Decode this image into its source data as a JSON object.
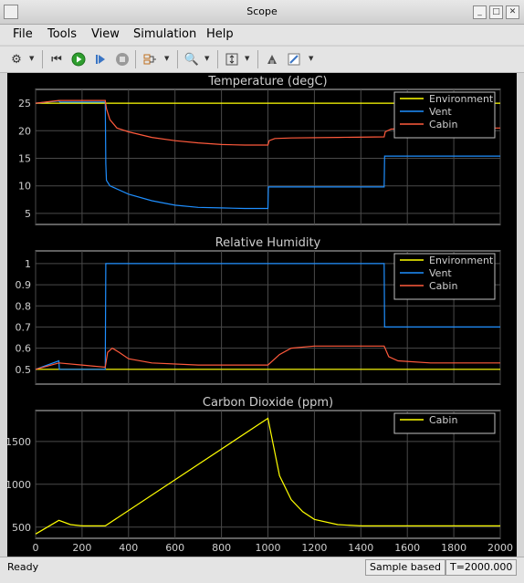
{
  "window": {
    "title": "Scope"
  },
  "menu": {
    "file": "File",
    "tools": "Tools",
    "view": "View",
    "simulation": "Simulation",
    "help": "Help"
  },
  "status": {
    "ready": "Ready",
    "mode": "Sample based",
    "time": "T=2000.000"
  },
  "colors": {
    "environment": "#ffff00",
    "vent": "#1f8fff",
    "cabin": "#ff5a3c",
    "co2": "#ffff00"
  },
  "chart_data": [
    {
      "type": "line",
      "title": "Temperature (degC)",
      "xlim": [
        0,
        2000
      ],
      "ylim": [
        3,
        27.5
      ],
      "yticks": [
        5,
        10,
        15,
        20,
        25
      ],
      "legend": "top-right",
      "series": [
        {
          "name": "Environment",
          "color": "#ffff00",
          "points": [
            [
              0,
              25
            ],
            [
              2000,
              25
            ]
          ]
        },
        {
          "name": "Vent",
          "color": "#1f8fff",
          "points": [
            [
              0,
              25
            ],
            [
              100,
              25.4
            ],
            [
              105,
              25.2
            ],
            [
              300,
              25.2
            ],
            [
              302,
              14
            ],
            [
              305,
              11
            ],
            [
              320,
              10
            ],
            [
              400,
              8.5
            ],
            [
              500,
              7.3
            ],
            [
              600,
              6.5
            ],
            [
              700,
              6.1
            ],
            [
              800,
              6
            ],
            [
              900,
              5.9
            ],
            [
              1000,
              5.9
            ],
            [
              1002,
              9.8
            ],
            [
              1100,
              9.8
            ],
            [
              1200,
              9.8
            ],
            [
              1500,
              9.8
            ],
            [
              1502,
              15.4
            ],
            [
              1600,
              15.4
            ],
            [
              2000,
              15.4
            ]
          ]
        },
        {
          "name": "Cabin",
          "color": "#ff5a3c",
          "points": [
            [
              0,
              25
            ],
            [
              100,
              25.5
            ],
            [
              300,
              25.5
            ],
            [
              305,
              24
            ],
            [
              320,
              22
            ],
            [
              350,
              20.5
            ],
            [
              400,
              19.8
            ],
            [
              500,
              18.8
            ],
            [
              600,
              18.2
            ],
            [
              700,
              17.8
            ],
            [
              800,
              17.5
            ],
            [
              900,
              17.4
            ],
            [
              1000,
              17.4
            ],
            [
              1005,
              18.2
            ],
            [
              1030,
              18.6
            ],
            [
              1100,
              18.7
            ],
            [
              1300,
              18.8
            ],
            [
              1500,
              18.9
            ],
            [
              1505,
              19.8
            ],
            [
              1530,
              20.3
            ],
            [
              1600,
              20.4
            ],
            [
              2000,
              20.5
            ]
          ]
        }
      ]
    },
    {
      "type": "line",
      "title": "Relative Humidity",
      "xlim": [
        0,
        2000
      ],
      "ylim": [
        0.43,
        1.06
      ],
      "yticks": [
        0.5,
        0.6,
        0.7,
        0.8,
        0.9,
        1
      ],
      "legend": "top-right",
      "series": [
        {
          "name": "Environment",
          "color": "#ffff00",
          "points": [
            [
              0,
              0.5
            ],
            [
              2000,
              0.5
            ]
          ]
        },
        {
          "name": "Vent",
          "color": "#1f8fff",
          "points": [
            [
              0,
              0.5
            ],
            [
              100,
              0.54
            ],
            [
              102,
              0.5
            ],
            [
              300,
              0.5
            ],
            [
              302,
              1
            ],
            [
              1500,
              1
            ],
            [
              1502,
              0.7
            ],
            [
              2000,
              0.7
            ]
          ]
        },
        {
          "name": "Cabin",
          "color": "#ff5a3c",
          "points": [
            [
              0,
              0.5
            ],
            [
              100,
              0.53
            ],
            [
              200,
              0.52
            ],
            [
              300,
              0.51
            ],
            [
              310,
              0.58
            ],
            [
              330,
              0.6
            ],
            [
              360,
              0.58
            ],
            [
              400,
              0.55
            ],
            [
              500,
              0.53
            ],
            [
              700,
              0.52
            ],
            [
              1000,
              0.52
            ],
            [
              1050,
              0.57
            ],
            [
              1100,
              0.6
            ],
            [
              1200,
              0.61
            ],
            [
              1300,
              0.61
            ],
            [
              1500,
              0.61
            ],
            [
              1520,
              0.56
            ],
            [
              1560,
              0.54
            ],
            [
              1700,
              0.53
            ],
            [
              2000,
              0.53
            ]
          ]
        }
      ]
    },
    {
      "type": "line",
      "title": "Carbon Dioxide (ppm)",
      "xlim": [
        0,
        2000
      ],
      "ylim": [
        370,
        1860
      ],
      "yticks": [
        500,
        1000,
        1500
      ],
      "xticks": [
        0,
        200,
        400,
        600,
        800,
        1000,
        1200,
        1400,
        1600,
        1800,
        2000
      ],
      "legend": "top-right",
      "series": [
        {
          "name": "Cabin",
          "color": "#ffff00",
          "points": [
            [
              0,
              420
            ],
            [
              100,
              580
            ],
            [
              150,
              530
            ],
            [
              200,
              515
            ],
            [
              300,
              515
            ],
            [
              1000,
              1770
            ],
            [
              1050,
              1100
            ],
            [
              1100,
              820
            ],
            [
              1150,
              680
            ],
            [
              1200,
              590
            ],
            [
              1300,
              530
            ],
            [
              1400,
              515
            ],
            [
              2000,
              515
            ]
          ]
        }
      ]
    }
  ]
}
